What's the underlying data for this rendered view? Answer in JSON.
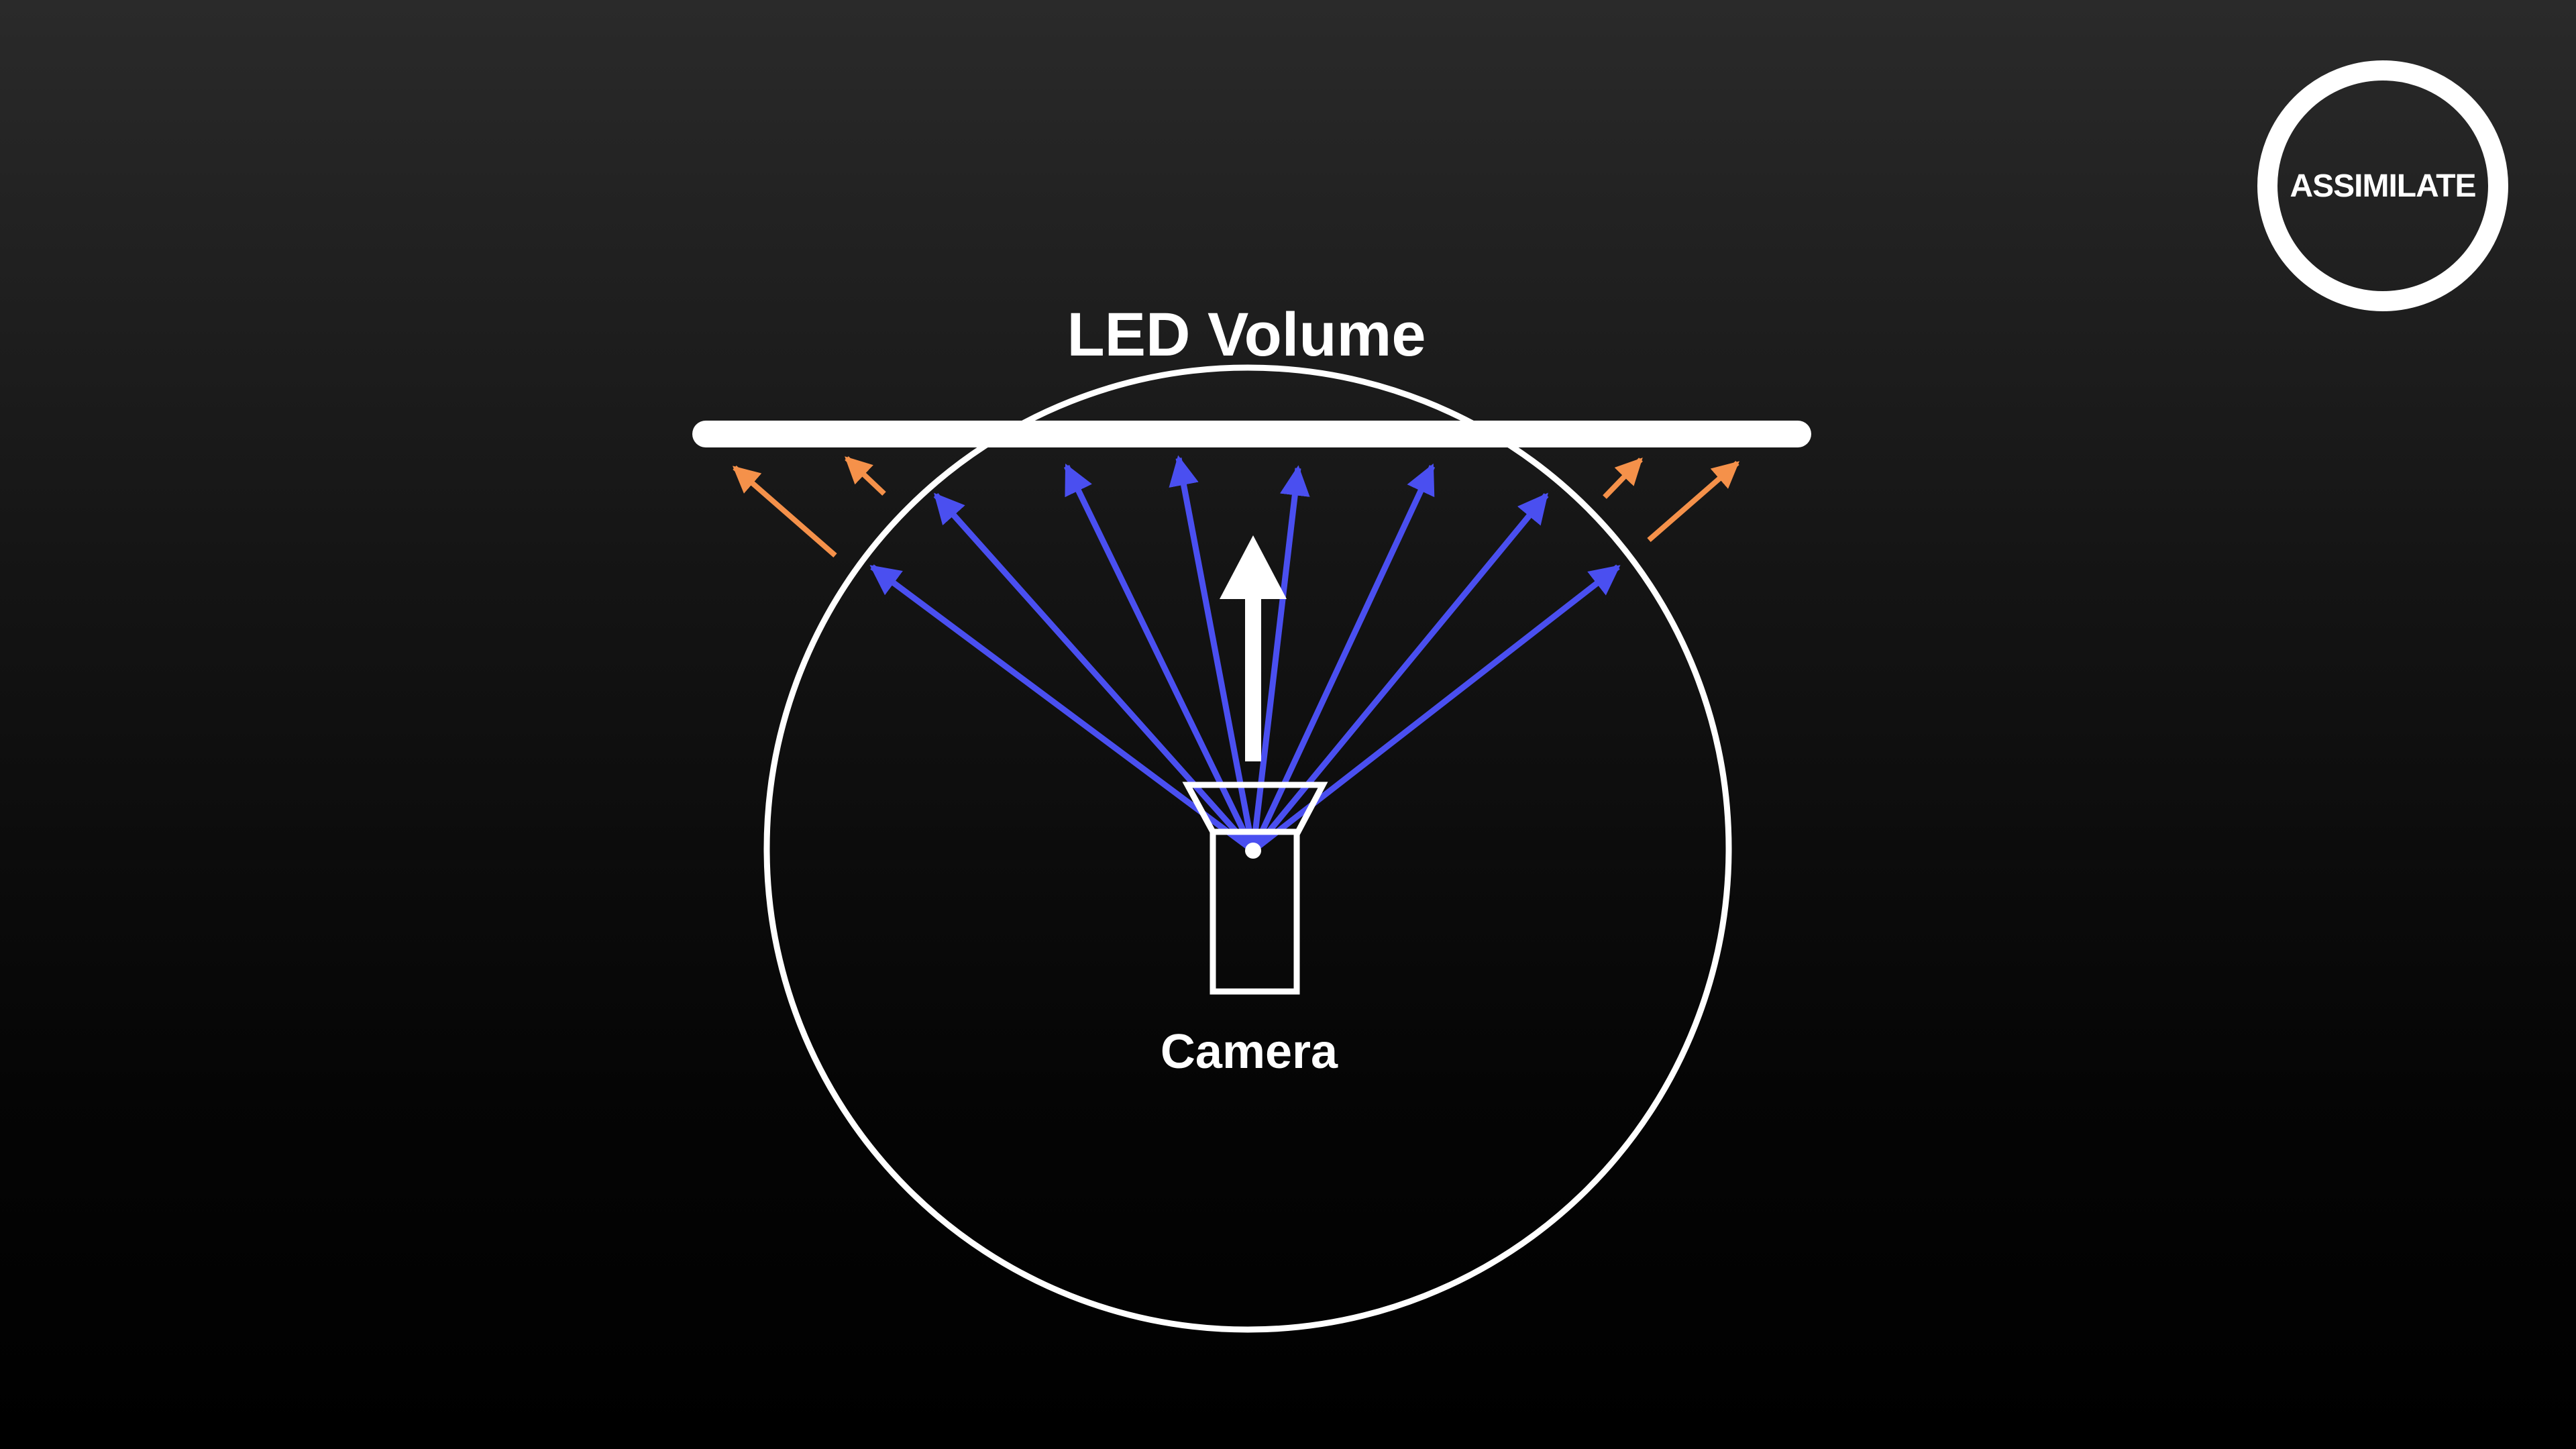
{
  "diagram": {
    "title": "LED Volume",
    "camera_label": "Camera",
    "colors": {
      "background_top": "#2a2a2a",
      "background_bottom": "#000000",
      "outline": "#ffffff",
      "in_frustum_rays": "#4a4ff0",
      "outside_frustum_rays": "#f5914a"
    }
  },
  "logo": {
    "text": "ASSIMILATE",
    "icon": "ring-play-icon"
  }
}
